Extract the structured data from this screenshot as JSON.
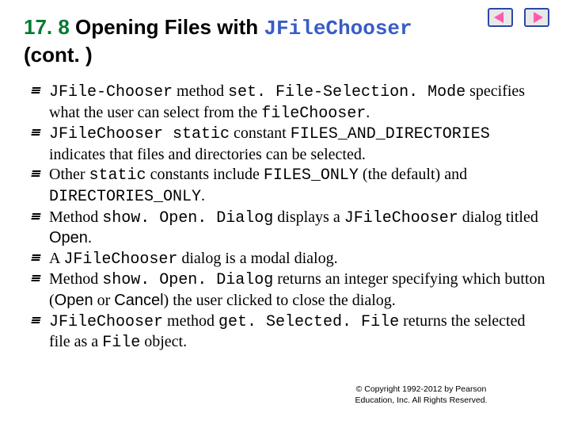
{
  "heading": {
    "section_number": "17. 8",
    "title_text": " Opening Files with ",
    "jfc": "JFileChooser",
    "cont": "(cont. )"
  },
  "bullets": [
    {
      "parts": [
        {
          "t": "JFile-Chooser",
          "cls": "mono"
        },
        {
          "t": " method "
        },
        {
          "t": "set. File-Selection. Mode",
          "cls": "mono"
        },
        {
          "t": " specifies what the user can select from the "
        },
        {
          "t": "fileChooser",
          "cls": "mono"
        },
        {
          "t": "."
        }
      ]
    },
    {
      "parts": [
        {
          "t": "JFileChooser static",
          "cls": "mono"
        },
        {
          "t": " constant "
        },
        {
          "t": "FILES_AND_DIRECTORIES",
          "cls": "mono"
        },
        {
          "t": " indicates that files and directories can be selected."
        }
      ]
    },
    {
      "parts": [
        {
          "t": "Other "
        },
        {
          "t": "static",
          "cls": "mono"
        },
        {
          "t": " constants include "
        },
        {
          "t": "FILES_ONLY",
          "cls": "mono"
        },
        {
          "t": " (the default) and "
        },
        {
          "t": "DIRECTORIES_ONLY",
          "cls": "mono"
        },
        {
          "t": "."
        }
      ]
    },
    {
      "parts": [
        {
          "t": "Method "
        },
        {
          "t": "show. Open. Dialog",
          "cls": "mono"
        },
        {
          "t": " displays a "
        },
        {
          "t": "JFileChooser",
          "cls": "mono"
        },
        {
          "t": " dialog titled "
        },
        {
          "t": "Open",
          "cls": "sans"
        },
        {
          "t": "."
        }
      ]
    },
    {
      "parts": [
        {
          "t": "A "
        },
        {
          "t": "JFileChooser",
          "cls": "mono"
        },
        {
          "t": " dialog is a modal dialog."
        }
      ]
    },
    {
      "parts": [
        {
          "t": "Method "
        },
        {
          "t": "show. Open. Dialog",
          "cls": "mono"
        },
        {
          "t": " returns an integer specifying which button ("
        },
        {
          "t": "Open",
          "cls": "sans"
        },
        {
          "t": " or "
        },
        {
          "t": "Cancel",
          "cls": "sans"
        },
        {
          "t": ") the user clicked to close the dialog."
        }
      ]
    },
    {
      "parts": [
        {
          "t": "JFileChooser",
          "cls": "mono"
        },
        {
          "t": " method "
        },
        {
          "t": "get. Selected. File",
          "cls": "mono"
        },
        {
          "t": " returns the selected file as a "
        },
        {
          "t": "File",
          "cls": "mono"
        },
        {
          "t": " object."
        }
      ]
    }
  ],
  "footer": {
    "line1": "© Copyright 1992-2012 by Pearson",
    "line2": "Education, Inc. All Rights Reserved."
  },
  "nav": {
    "prev": "prev-slide",
    "next": "next-slide"
  }
}
